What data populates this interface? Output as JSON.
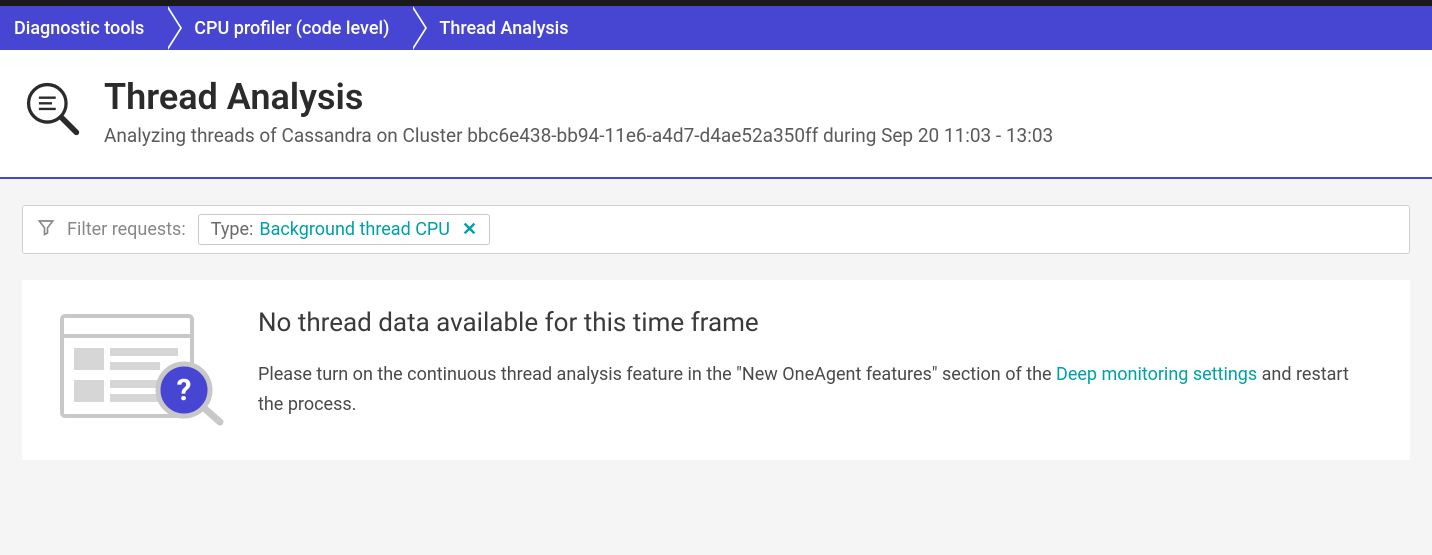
{
  "breadcrumb": {
    "items": [
      {
        "label": "Diagnostic tools"
      },
      {
        "label": "CPU profiler (code level)"
      },
      {
        "label": "Thread Analysis"
      }
    ]
  },
  "header": {
    "title": "Thread Analysis",
    "subtitle": "Analyzing threads of Cassandra on Cluster bbc6e438-bb94-11e6-a4d7-d4ae52a350ff during Sep 20 11:03 - 13:03"
  },
  "filter": {
    "label": "Filter requests:",
    "chip": {
      "key": "Type:",
      "value": "Background thread CPU"
    }
  },
  "message": {
    "title": "No thread data available for this time frame",
    "body_before": "Please turn on the continuous thread analysis feature in the \"New OneAgent features\" section of the ",
    "link": "Deep monitoring settings",
    "body_after": " and restart the process."
  }
}
